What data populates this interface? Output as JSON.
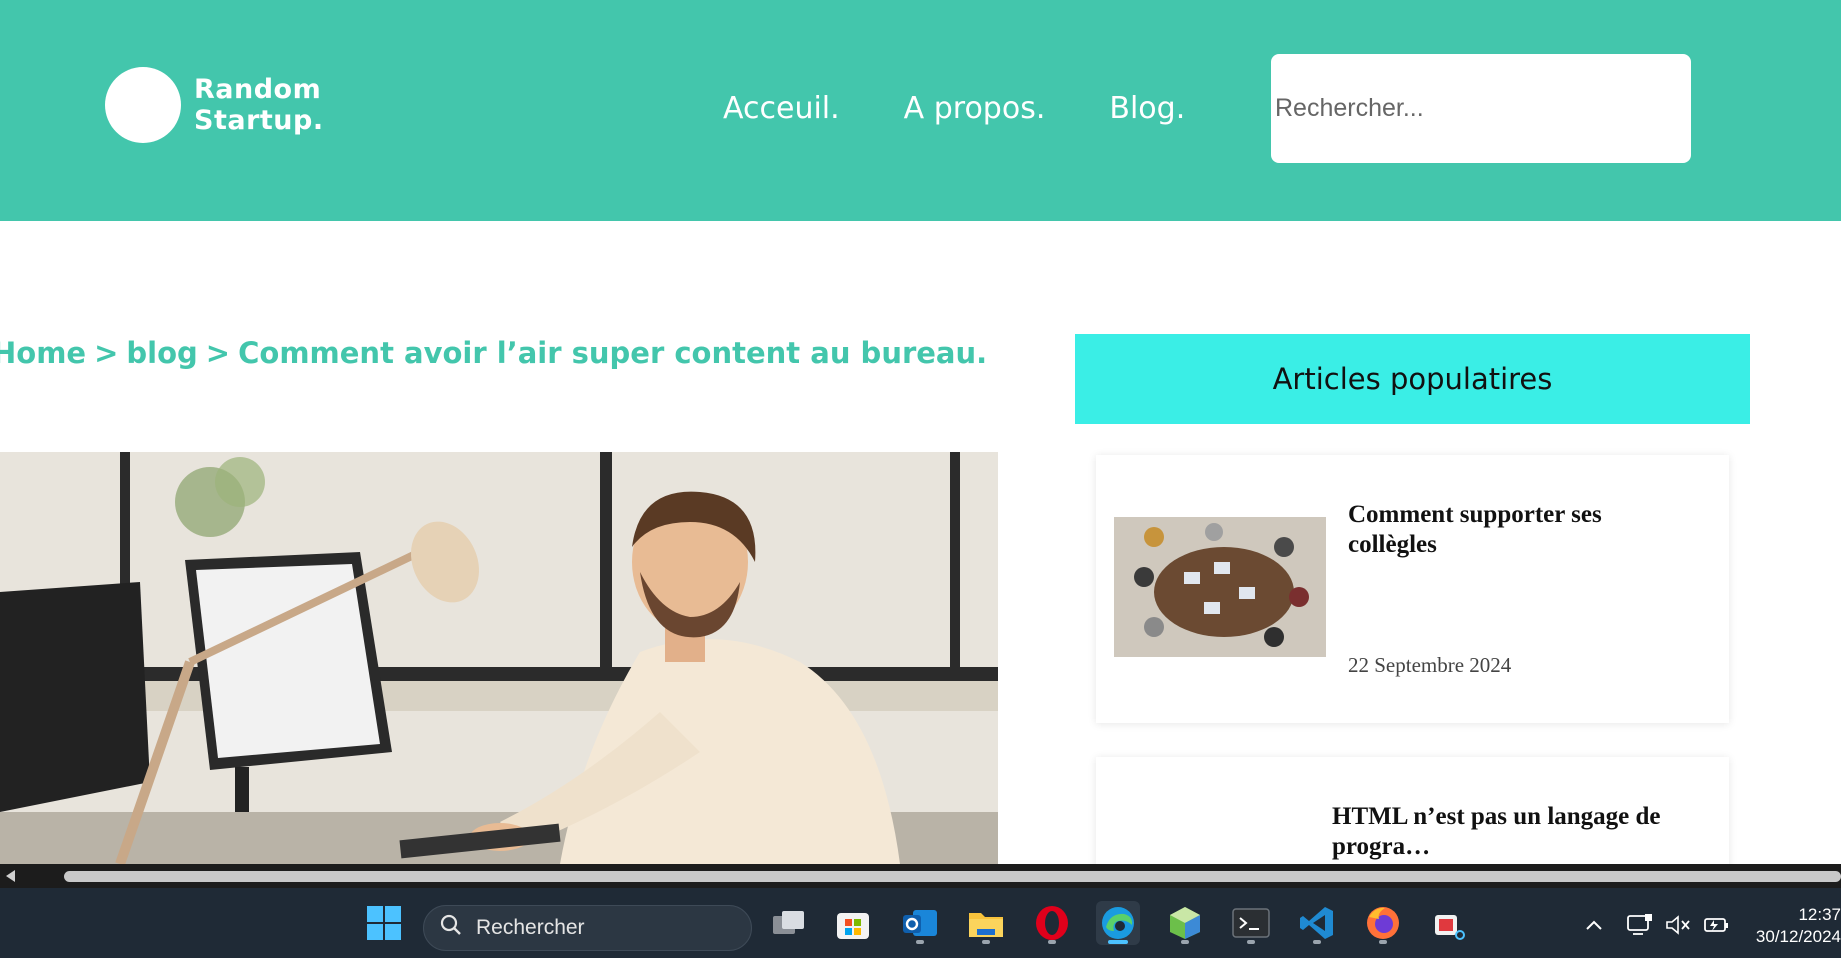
{
  "header": {
    "logo_line1": "Random",
    "logo_line2": "Startup.",
    "nav": [
      "Acceuil.",
      "A propos.",
      "Blog."
    ],
    "search_placeholder": "Rechercher...",
    "brand_color": "#43c6ac"
  },
  "breadcrumb": {
    "home": "Home",
    "sep": ">",
    "blog": "blog",
    "current": "Comment avoir l’air super content au bureau."
  },
  "sidebar": {
    "heading": "Articles populatires",
    "heading_color": "#3aeee6",
    "cards": [
      {
        "title": "Comment supporter ses collègles",
        "date": "22 Septembre 2024"
      },
      {
        "title": "HTML n’est pas un langage de progra…"
      }
    ]
  },
  "taskbar": {
    "search_label": "Rechercher",
    "apps": [
      "windows-start-icon",
      "task-view-icon",
      "microsoft-store-icon",
      "outlook-icon",
      "file-explorer-icon",
      "opera-icon",
      "edge-icon",
      "box-app-icon",
      "terminal-icon",
      "vscode-icon",
      "firefox-icon",
      "snipping-tool-icon"
    ],
    "time": "12:37",
    "date": "30/12/2024"
  }
}
